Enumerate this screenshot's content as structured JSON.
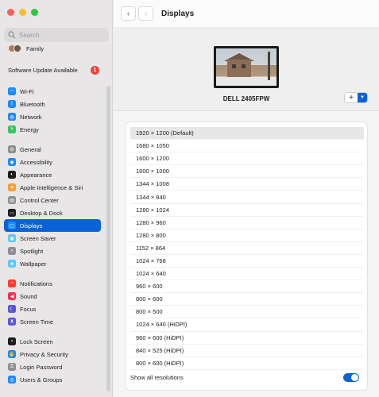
{
  "window": {
    "traffic_lights": {
      "close": "#fe5f57",
      "minimize": "#febc2e",
      "zoom": "#28c840"
    }
  },
  "sidebar": {
    "search_placeholder": "Search",
    "family_label": "Family",
    "software_update_label": "Software Update Available",
    "software_update_badge": "1",
    "groups": [
      [
        {
          "name": "wifi",
          "label": "Wi-Fi",
          "icon": "wifi-icon",
          "color": "#1d8cf8"
        },
        {
          "name": "bluetooth",
          "label": "Bluetooth",
          "icon": "bluetooth-icon",
          "color": "#1d8cf8"
        },
        {
          "name": "network",
          "label": "Network",
          "icon": "globe-icon",
          "color": "#1d8cf8"
        },
        {
          "name": "energy",
          "label": "Energy",
          "icon": "bolt-icon",
          "color": "#34c759"
        }
      ],
      [
        {
          "name": "general",
          "label": "General",
          "icon": "gear-icon",
          "color": "#8e8e93"
        },
        {
          "name": "accessibility",
          "label": "Accessibility",
          "icon": "accessibility-icon",
          "color": "#1d8cf8"
        },
        {
          "name": "appearance",
          "label": "Appearance",
          "icon": "appearance-icon",
          "color": "#1c1c1e"
        },
        {
          "name": "apple-intelligence",
          "label": "Apple Intelligence & Siri",
          "icon": "siri-icon",
          "color": "#f0a040"
        },
        {
          "name": "control-center",
          "label": "Control Center",
          "icon": "control-center-icon",
          "color": "#8e8e93"
        },
        {
          "name": "desktop-dock",
          "label": "Desktop & Dock",
          "icon": "dock-icon",
          "color": "#1c1c1e"
        },
        {
          "name": "displays",
          "label": "Displays",
          "icon": "display-icon",
          "color": "#1d8cf8",
          "selected": true
        },
        {
          "name": "screen-saver",
          "label": "Screen Saver",
          "icon": "screen-saver-icon",
          "color": "#5ac8fa"
        },
        {
          "name": "spotlight",
          "label": "Spotlight",
          "icon": "magnifier-icon",
          "color": "#8e8e93"
        },
        {
          "name": "wallpaper",
          "label": "Wallpaper",
          "icon": "wallpaper-icon",
          "color": "#5ac8fa"
        }
      ],
      [
        {
          "name": "notifications",
          "label": "Notifications",
          "icon": "bell-icon",
          "color": "#ff3b30"
        },
        {
          "name": "sound",
          "label": "Sound",
          "icon": "speaker-icon",
          "color": "#ff2d55"
        },
        {
          "name": "focus",
          "label": "Focus",
          "icon": "moon-icon",
          "color": "#5856d6"
        },
        {
          "name": "screen-time",
          "label": "Screen Time",
          "icon": "hourglass-icon",
          "color": "#5856d6"
        }
      ],
      [
        {
          "name": "lock-screen",
          "label": "Lock Screen",
          "icon": "lock-icon",
          "color": "#1c1c1e"
        },
        {
          "name": "privacy-security",
          "label": "Privacy & Security",
          "icon": "hand-icon",
          "color": "#1d8cf8"
        },
        {
          "name": "login-password",
          "label": "Login Password",
          "icon": "key-icon",
          "color": "#8e8e93"
        },
        {
          "name": "users-groups",
          "label": "Users & Groups",
          "icon": "users-icon",
          "color": "#1d8cf8"
        }
      ]
    ]
  },
  "toolbar": {
    "back_icon": "chevron-left-icon",
    "forward_icon": "chevron-right-icon",
    "title": "Displays"
  },
  "display": {
    "monitor_name": "DELL 2405FPW",
    "add_icon": "plus-icon",
    "menu_icon": "chevron-down-icon"
  },
  "resolutions": {
    "items": [
      "1920 × 1200 (Default)",
      "1680 × 1050",
      "1600 × 1200",
      "1600 × 1000",
      "1344 × 1008",
      "1344 × 840",
      "1280 × 1024",
      "1280 × 960",
      "1280 × 800",
      "1152 × 864",
      "1024 × 768",
      "1024 × 640",
      "960 × 600",
      "800 × 600",
      "800 × 500",
      "1024 × 640 (HiDPI)",
      "960 × 600 (HiDPI)",
      "840 × 525 (HiDPI)",
      "800 × 600 (HiDPI)"
    ],
    "selected_index": 0,
    "show_all_label": "Show all resolutions",
    "show_all_enabled": true
  },
  "colors": {
    "accent": "#0a63d6"
  }
}
